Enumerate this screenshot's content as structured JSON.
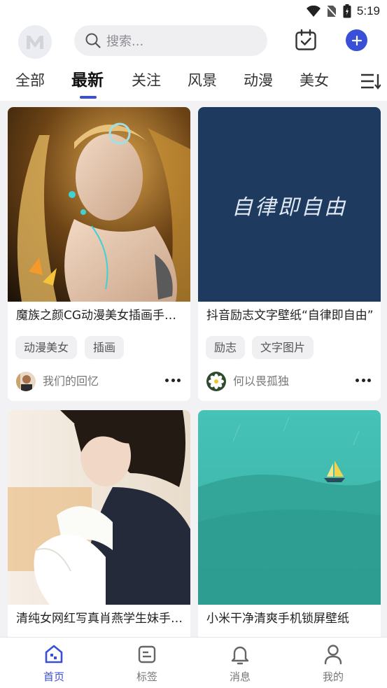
{
  "status_bar": {
    "time": "5:19"
  },
  "header": {
    "search_placeholder": "搜索...",
    "accent_color": "#3a4fd7"
  },
  "tabs": [
    {
      "label": "全部",
      "active": false
    },
    {
      "label": "最新",
      "active": true
    },
    {
      "label": "关注",
      "active": false
    },
    {
      "label": "风景",
      "active": false
    },
    {
      "label": "动漫",
      "active": false
    },
    {
      "label": "美女",
      "active": false
    }
  ],
  "cards": [
    {
      "title": "魔族之颜CG动漫美女插画手机壁纸",
      "tags": [
        "动漫美女",
        "插画"
      ],
      "author": "我们的回忆"
    },
    {
      "title": "抖音励志文字壁纸“自律即自由”",
      "image_text": "自律即自由",
      "tags": [
        "励志",
        "文字图片"
      ],
      "author": "何以畏孤独"
    },
    {
      "title": "清纯女网红写真肖燕学生妹手机壁纸",
      "tags": [],
      "author": ""
    },
    {
      "title": "小米干净清爽手机锁屏壁纸",
      "tags": [],
      "author": ""
    }
  ],
  "bottom_nav": [
    {
      "label": "首页",
      "icon": "home-icon",
      "active": true
    },
    {
      "label": "标签",
      "icon": "tag-icon",
      "active": false
    },
    {
      "label": "消息",
      "icon": "bell-icon",
      "active": false
    },
    {
      "label": "我的",
      "icon": "user-icon",
      "active": false
    }
  ]
}
